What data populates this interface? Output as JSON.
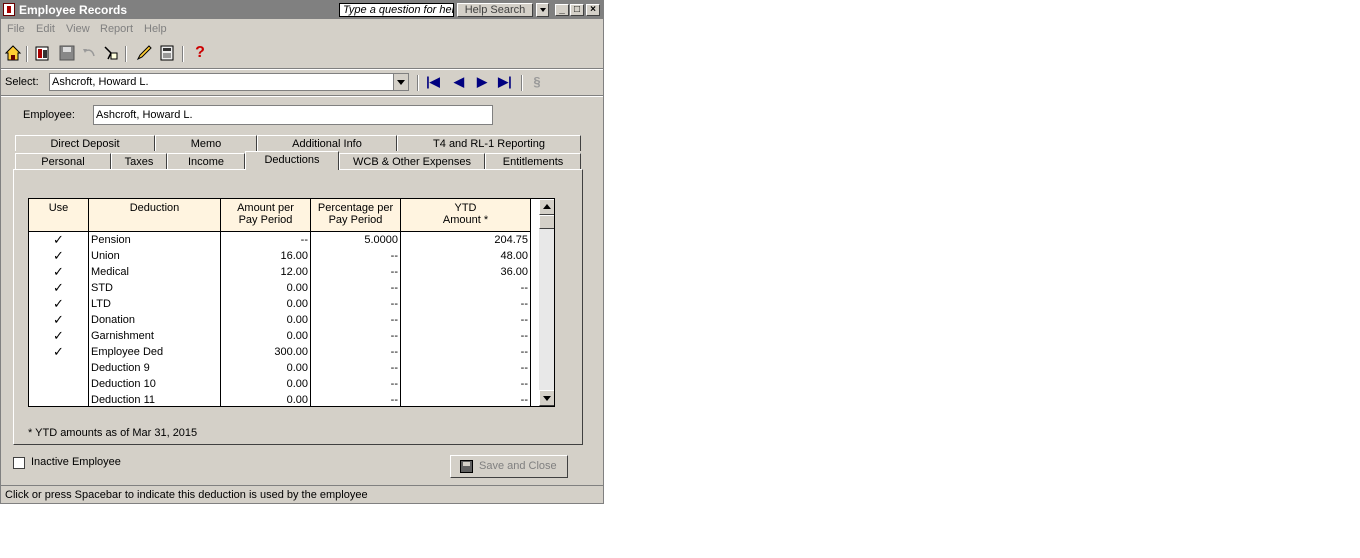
{
  "window": {
    "title": "Employee Records"
  },
  "help": {
    "prompt": "Type a question for help",
    "search_label": "Help Search"
  },
  "menu": {
    "items": [
      "File",
      "Edit",
      "View",
      "Report",
      "Help"
    ]
  },
  "selector": {
    "label": "Select:",
    "value": "Ashcroft, Howard L."
  },
  "employee": {
    "label": "Employee:",
    "value": "Ashcroft, Howard L."
  },
  "tabs": {
    "row1": [
      "Direct Deposit",
      "Memo",
      "Additional Info",
      "T4 and RL-1 Reporting"
    ],
    "row2": [
      "Personal",
      "Taxes",
      "Income",
      "Deductions",
      "WCB & Other Expenses",
      "Entitlements"
    ],
    "active": "Deductions"
  },
  "grid": {
    "headers": {
      "use": "Use",
      "deduction": "Deduction",
      "amount": [
        "Amount per",
        "Pay Period"
      ],
      "percent": [
        "Percentage per",
        "Pay Period"
      ],
      "ytd": [
        "YTD",
        "Amount *"
      ]
    },
    "rows": [
      {
        "use": "✓",
        "name": "Pension",
        "amount": "--",
        "percent": "5.0000",
        "ytd": "204.75"
      },
      {
        "use": "✓",
        "name": "Union",
        "amount": "16.00",
        "percent": "--",
        "ytd": "48.00"
      },
      {
        "use": "✓",
        "name": "Medical",
        "amount": "12.00",
        "percent": "--",
        "ytd": "36.00"
      },
      {
        "use": "✓",
        "name": "STD",
        "amount": "0.00",
        "percent": "--",
        "ytd": "--"
      },
      {
        "use": "✓",
        "name": "LTD",
        "amount": "0.00",
        "percent": "--",
        "ytd": "--"
      },
      {
        "use": "✓",
        "name": "Donation",
        "amount": "0.00",
        "percent": "--",
        "ytd": "--"
      },
      {
        "use": "✓",
        "name": "Garnishment",
        "amount": "0.00",
        "percent": "--",
        "ytd": "--"
      },
      {
        "use": "✓",
        "name": "Employee Ded",
        "amount": "300.00",
        "percent": "--",
        "ytd": "--"
      },
      {
        "use": "",
        "name": "Deduction 9",
        "amount": "0.00",
        "percent": "--",
        "ytd": "--"
      },
      {
        "use": "",
        "name": "Deduction 10",
        "amount": "0.00",
        "percent": "--",
        "ytd": "--"
      },
      {
        "use": "",
        "name": "Deduction 11",
        "amount": "0.00",
        "percent": "--",
        "ytd": "--"
      }
    ]
  },
  "footnote": "* YTD amounts as of Mar 31, 2015",
  "inactive": {
    "label": "Inactive Employee",
    "checked": false
  },
  "save_button": {
    "label": "Save and Close"
  },
  "status": "Click or press Spacebar to indicate this deduction is used by the employee"
}
